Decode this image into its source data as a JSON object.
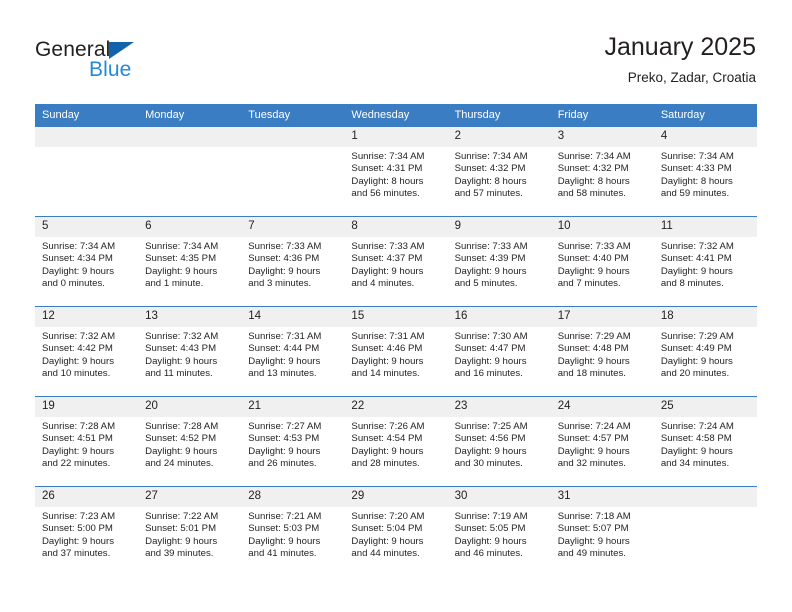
{
  "brand": {
    "name_part1": "General",
    "name_part2": "Blue",
    "triangle_color": "#1362ad",
    "blue_color": "#2389d8"
  },
  "header": {
    "title": "January 2025",
    "subtitle": "Preko, Zadar, Croatia"
  },
  "theme": {
    "header_blue": "#3b7dc3",
    "daynum_bg": "#f0f0f0",
    "text": "#231f20"
  },
  "weekday_headers": [
    "Sunday",
    "Monday",
    "Tuesday",
    "Wednesday",
    "Thursday",
    "Friday",
    "Saturday"
  ],
  "weeks": [
    [
      {
        "day": "",
        "sunrise": "",
        "sunset": "",
        "daylight_line1": "",
        "daylight_line2": "",
        "empty": true
      },
      {
        "day": "",
        "sunrise": "",
        "sunset": "",
        "daylight_line1": "",
        "daylight_line2": "",
        "empty": true
      },
      {
        "day": "",
        "sunrise": "",
        "sunset": "",
        "daylight_line1": "",
        "daylight_line2": "",
        "empty": true
      },
      {
        "day": "1",
        "sunrise": "Sunrise: 7:34 AM",
        "sunset": "Sunset: 4:31 PM",
        "daylight_line1": "Daylight: 8 hours",
        "daylight_line2": "and 56 minutes.",
        "empty": false
      },
      {
        "day": "2",
        "sunrise": "Sunrise: 7:34 AM",
        "sunset": "Sunset: 4:32 PM",
        "daylight_line1": "Daylight: 8 hours",
        "daylight_line2": "and 57 minutes.",
        "empty": false
      },
      {
        "day": "3",
        "sunrise": "Sunrise: 7:34 AM",
        "sunset": "Sunset: 4:32 PM",
        "daylight_line1": "Daylight: 8 hours",
        "daylight_line2": "and 58 minutes.",
        "empty": false
      },
      {
        "day": "4",
        "sunrise": "Sunrise: 7:34 AM",
        "sunset": "Sunset: 4:33 PM",
        "daylight_line1": "Daylight: 8 hours",
        "daylight_line2": "and 59 minutes.",
        "empty": false
      }
    ],
    [
      {
        "day": "5",
        "sunrise": "Sunrise: 7:34 AM",
        "sunset": "Sunset: 4:34 PM",
        "daylight_line1": "Daylight: 9 hours",
        "daylight_line2": "and 0 minutes.",
        "empty": false
      },
      {
        "day": "6",
        "sunrise": "Sunrise: 7:34 AM",
        "sunset": "Sunset: 4:35 PM",
        "daylight_line1": "Daylight: 9 hours",
        "daylight_line2": "and 1 minute.",
        "empty": false
      },
      {
        "day": "7",
        "sunrise": "Sunrise: 7:33 AM",
        "sunset": "Sunset: 4:36 PM",
        "daylight_line1": "Daylight: 9 hours",
        "daylight_line2": "and 3 minutes.",
        "empty": false
      },
      {
        "day": "8",
        "sunrise": "Sunrise: 7:33 AM",
        "sunset": "Sunset: 4:37 PM",
        "daylight_line1": "Daylight: 9 hours",
        "daylight_line2": "and 4 minutes.",
        "empty": false
      },
      {
        "day": "9",
        "sunrise": "Sunrise: 7:33 AM",
        "sunset": "Sunset: 4:39 PM",
        "daylight_line1": "Daylight: 9 hours",
        "daylight_line2": "and 5 minutes.",
        "empty": false
      },
      {
        "day": "10",
        "sunrise": "Sunrise: 7:33 AM",
        "sunset": "Sunset: 4:40 PM",
        "daylight_line1": "Daylight: 9 hours",
        "daylight_line2": "and 7 minutes.",
        "empty": false
      },
      {
        "day": "11",
        "sunrise": "Sunrise: 7:32 AM",
        "sunset": "Sunset: 4:41 PM",
        "daylight_line1": "Daylight: 9 hours",
        "daylight_line2": "and 8 minutes.",
        "empty": false
      }
    ],
    [
      {
        "day": "12",
        "sunrise": "Sunrise: 7:32 AM",
        "sunset": "Sunset: 4:42 PM",
        "daylight_line1": "Daylight: 9 hours",
        "daylight_line2": "and 10 minutes.",
        "empty": false
      },
      {
        "day": "13",
        "sunrise": "Sunrise: 7:32 AM",
        "sunset": "Sunset: 4:43 PM",
        "daylight_line1": "Daylight: 9 hours",
        "daylight_line2": "and 11 minutes.",
        "empty": false
      },
      {
        "day": "14",
        "sunrise": "Sunrise: 7:31 AM",
        "sunset": "Sunset: 4:44 PM",
        "daylight_line1": "Daylight: 9 hours",
        "daylight_line2": "and 13 minutes.",
        "empty": false
      },
      {
        "day": "15",
        "sunrise": "Sunrise: 7:31 AM",
        "sunset": "Sunset: 4:46 PM",
        "daylight_line1": "Daylight: 9 hours",
        "daylight_line2": "and 14 minutes.",
        "empty": false
      },
      {
        "day": "16",
        "sunrise": "Sunrise: 7:30 AM",
        "sunset": "Sunset: 4:47 PM",
        "daylight_line1": "Daylight: 9 hours",
        "daylight_line2": "and 16 minutes.",
        "empty": false
      },
      {
        "day": "17",
        "sunrise": "Sunrise: 7:29 AM",
        "sunset": "Sunset: 4:48 PM",
        "daylight_line1": "Daylight: 9 hours",
        "daylight_line2": "and 18 minutes.",
        "empty": false
      },
      {
        "day": "18",
        "sunrise": "Sunrise: 7:29 AM",
        "sunset": "Sunset: 4:49 PM",
        "daylight_line1": "Daylight: 9 hours",
        "daylight_line2": "and 20 minutes.",
        "empty": false
      }
    ],
    [
      {
        "day": "19",
        "sunrise": "Sunrise: 7:28 AM",
        "sunset": "Sunset: 4:51 PM",
        "daylight_line1": "Daylight: 9 hours",
        "daylight_line2": "and 22 minutes.",
        "empty": false
      },
      {
        "day": "20",
        "sunrise": "Sunrise: 7:28 AM",
        "sunset": "Sunset: 4:52 PM",
        "daylight_line1": "Daylight: 9 hours",
        "daylight_line2": "and 24 minutes.",
        "empty": false
      },
      {
        "day": "21",
        "sunrise": "Sunrise: 7:27 AM",
        "sunset": "Sunset: 4:53 PM",
        "daylight_line1": "Daylight: 9 hours",
        "daylight_line2": "and 26 minutes.",
        "empty": false
      },
      {
        "day": "22",
        "sunrise": "Sunrise: 7:26 AM",
        "sunset": "Sunset: 4:54 PM",
        "daylight_line1": "Daylight: 9 hours",
        "daylight_line2": "and 28 minutes.",
        "empty": false
      },
      {
        "day": "23",
        "sunrise": "Sunrise: 7:25 AM",
        "sunset": "Sunset: 4:56 PM",
        "daylight_line1": "Daylight: 9 hours",
        "daylight_line2": "and 30 minutes.",
        "empty": false
      },
      {
        "day": "24",
        "sunrise": "Sunrise: 7:24 AM",
        "sunset": "Sunset: 4:57 PM",
        "daylight_line1": "Daylight: 9 hours",
        "daylight_line2": "and 32 minutes.",
        "empty": false
      },
      {
        "day": "25",
        "sunrise": "Sunrise: 7:24 AM",
        "sunset": "Sunset: 4:58 PM",
        "daylight_line1": "Daylight: 9 hours",
        "daylight_line2": "and 34 minutes.",
        "empty": false
      }
    ],
    [
      {
        "day": "26",
        "sunrise": "Sunrise: 7:23 AM",
        "sunset": "Sunset: 5:00 PM",
        "daylight_line1": "Daylight: 9 hours",
        "daylight_line2": "and 37 minutes.",
        "empty": false
      },
      {
        "day": "27",
        "sunrise": "Sunrise: 7:22 AM",
        "sunset": "Sunset: 5:01 PM",
        "daylight_line1": "Daylight: 9 hours",
        "daylight_line2": "and 39 minutes.",
        "empty": false
      },
      {
        "day": "28",
        "sunrise": "Sunrise: 7:21 AM",
        "sunset": "Sunset: 5:03 PM",
        "daylight_line1": "Daylight: 9 hours",
        "daylight_line2": "and 41 minutes.",
        "empty": false
      },
      {
        "day": "29",
        "sunrise": "Sunrise: 7:20 AM",
        "sunset": "Sunset: 5:04 PM",
        "daylight_line1": "Daylight: 9 hours",
        "daylight_line2": "and 44 minutes.",
        "empty": false
      },
      {
        "day": "30",
        "sunrise": "Sunrise: 7:19 AM",
        "sunset": "Sunset: 5:05 PM",
        "daylight_line1": "Daylight: 9 hours",
        "daylight_line2": "and 46 minutes.",
        "empty": false
      },
      {
        "day": "31",
        "sunrise": "Sunrise: 7:18 AM",
        "sunset": "Sunset: 5:07 PM",
        "daylight_line1": "Daylight: 9 hours",
        "daylight_line2": "and 49 minutes.",
        "empty": false
      },
      {
        "day": "",
        "sunrise": "",
        "sunset": "",
        "daylight_line1": "",
        "daylight_line2": "",
        "empty": true
      }
    ]
  ]
}
